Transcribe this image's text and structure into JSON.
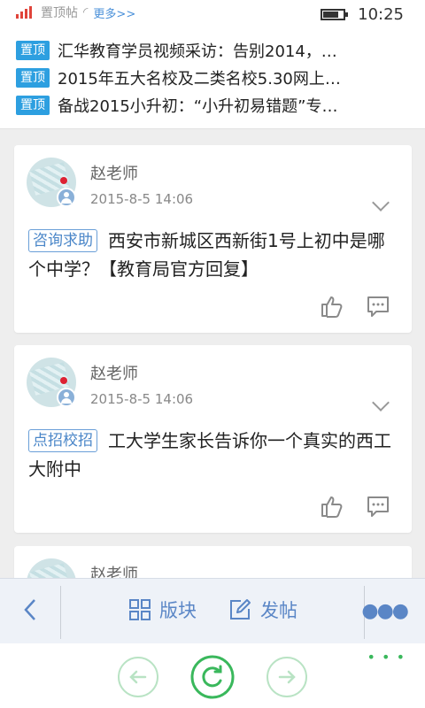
{
  "status_bar": {
    "app_text": "置顶帖",
    "more_link": "更多>>",
    "time": "10:25"
  },
  "pinned": {
    "badge": "置顶",
    "items": [
      {
        "text": "汇华教育学员视频采访：告别2014，…"
      },
      {
        "text": "2015年五大名校及二类名校5.30网上…"
      },
      {
        "text": "备战2015小升初：“小升初易错题”专…"
      }
    ]
  },
  "posts": [
    {
      "author": "赵老师",
      "time": "2015-8-5 14:06",
      "tag": "咨询求助",
      "title": "西安市新城区西新街1号上初中是哪个中学？【教育局官方回复】"
    },
    {
      "author": "赵老师",
      "time": "2015-8-5 14:06",
      "tag": "点招校招",
      "title": "工大学生家长告诉你一个真实的西工大附中"
    },
    {
      "author": "赵老师"
    }
  ],
  "toolbar": {
    "section_label": "版块",
    "post_label": "发帖"
  },
  "colors": {
    "accent": "#5a86c6",
    "pin_badge": "#2d9fe0",
    "nav_green": "#3ab85c"
  }
}
